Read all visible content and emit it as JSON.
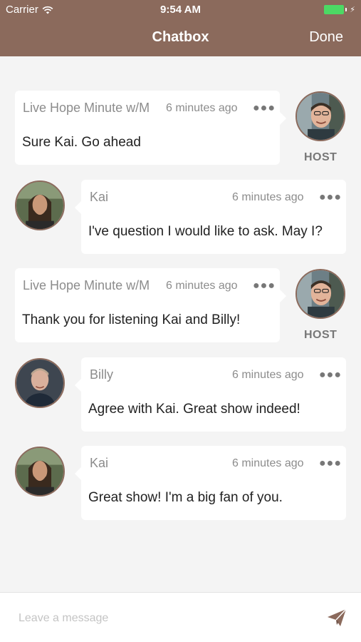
{
  "status_bar": {
    "carrier": "Carrier",
    "time": "9:54 AM"
  },
  "nav": {
    "title": "Chatbox",
    "done_label": "Done"
  },
  "messages": [
    {
      "sender": "Live Hope Minute w/M",
      "time": "6 minutes ago",
      "text": "Sure Kai. Go ahead",
      "side": "right",
      "role_label": "HOST",
      "avatar": "host-avatar"
    },
    {
      "sender": "Kai",
      "time": "6 minutes ago",
      "text": "I've question I would like to ask. May I?",
      "side": "left",
      "avatar": "kai-avatar"
    },
    {
      "sender": "Live Hope Minute w/M",
      "time": "6 minutes ago",
      "text": "Thank you for listening Kai and Billy!",
      "side": "right",
      "role_label": "HOST",
      "avatar": "host-avatar"
    },
    {
      "sender": "Billy",
      "time": "6 minutes ago",
      "text": "Agree with Kai. Great show indeed!",
      "side": "left",
      "avatar": "billy-avatar"
    },
    {
      "sender": "Kai",
      "time": "6 minutes ago",
      "text": "Great show! I'm a big fan of you.",
      "side": "left",
      "avatar": "kai-avatar"
    }
  ],
  "composer": {
    "placeholder": "Leave a message",
    "send_icon": "paper-plane-icon"
  },
  "colors": {
    "accent": "#8b6a5c",
    "background": "#f4f4f4",
    "bubble": "#ffffff",
    "battery": "#4cd964"
  }
}
